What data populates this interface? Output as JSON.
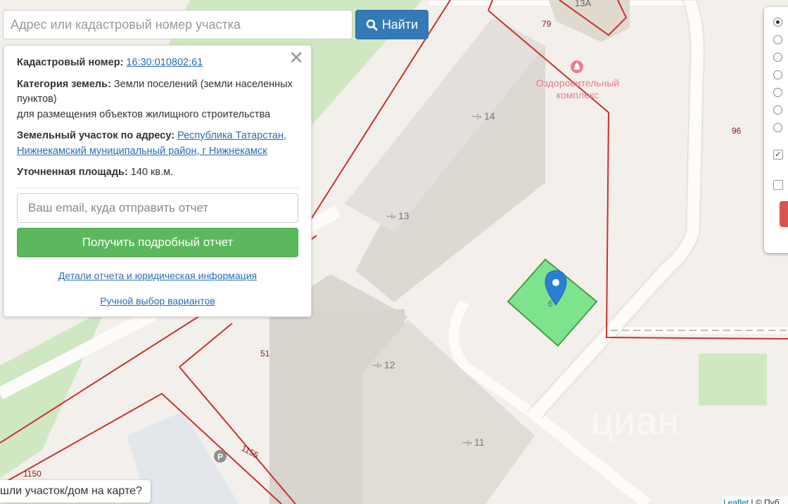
{
  "search": {
    "placeholder": "Адрес или кадастровый номер участка",
    "button_label": "Найти",
    "button_icon": "search-icon"
  },
  "popup": {
    "close_label": "✕",
    "cadastral_label": "Кадастровый номер:",
    "cadastral_value": "16:30:010802:61",
    "category_label": "Категория земель:",
    "category_value": "Земли поселений (земли населенных пунктов)",
    "purpose": "для размещения объектов жилищного строительства",
    "address_label": "Земельный участок по адресу:",
    "address_value": "Республика Татарстан, Нижнекамский муниципальный район, г Нижнекамск",
    "area_label": "Уточненная площадь:",
    "area_value": "140 кв.м.",
    "email_placeholder": "Ваш email, куда отправить отчет",
    "report_button": "Получить подробный отчет",
    "details_link": "Детали отчета и юридическая информация",
    "manual_link": "Ручной выбор вариантов"
  },
  "map": {
    "poi_label_line1": "Оздоровительный",
    "poi_label_line2": "комплекс",
    "poi_icon": "spa-icon",
    "house_numbers": [
      "14",
      "13",
      "12",
      "11"
    ],
    "entrance_icon": "entrance-icon",
    "parcel_numbers": [
      "13А",
      "79",
      "96",
      "51",
      "1155",
      "1150"
    ],
    "plot_label": "6",
    "marker_icon": "map-marker-icon",
    "parking_label": "P",
    "watermark": "циан",
    "colors": {
      "parcel_line": "#c8322c",
      "plot_fill": "#7de38d",
      "plot_stroke": "#4f9a45",
      "marker": "#2a7fd4",
      "green_area": "#cfe8c1"
    }
  },
  "layers": {
    "radio_count": 7,
    "selected_radio": 1,
    "checkbox1_checked": true,
    "checkbox2_checked": false
  },
  "bottom": {
    "found_label": "шли участок/дом на карте?"
  },
  "attribution": {
    "leaflet": "Leaflet",
    "separator": "|",
    "rest": "© Пуб"
  }
}
